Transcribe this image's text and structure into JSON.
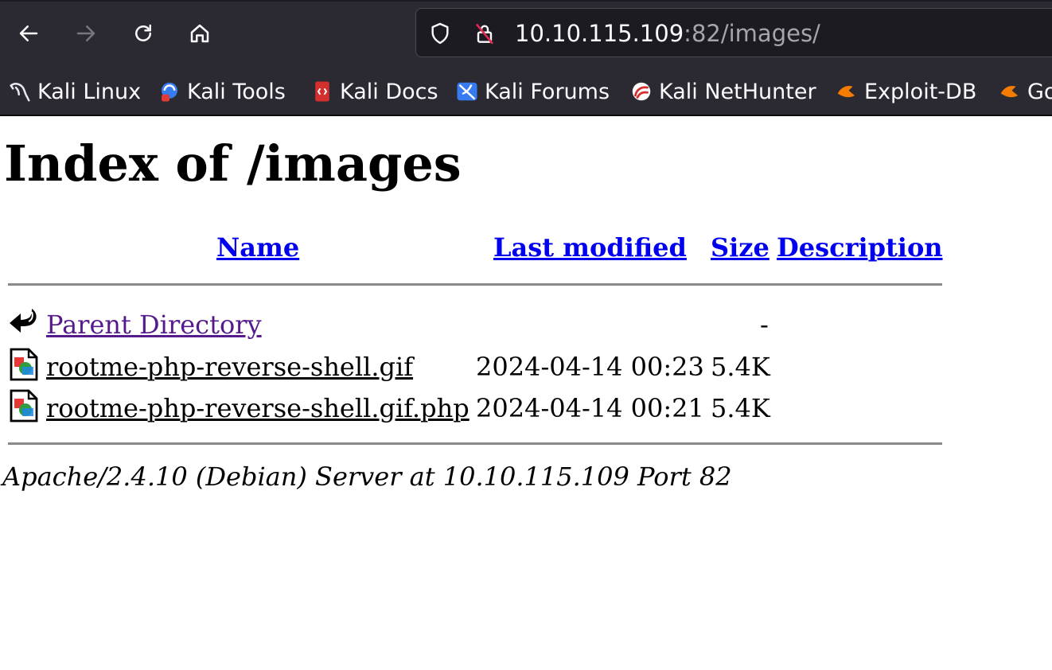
{
  "browser": {
    "address_host": "10.10.115.109",
    "address_rest": ":82/images/",
    "bookmarks": [
      {
        "label": "Kali Linux",
        "icon": "kali-dragon-icon"
      },
      {
        "label": "Kali Tools",
        "icon": "kali-tools-icon"
      },
      {
        "label": "Kali Docs",
        "icon": "kali-docs-icon"
      },
      {
        "label": "Kali Forums",
        "icon": "kali-forums-icon"
      },
      {
        "label": "Kali NetHunter",
        "icon": "kali-nethunter-icon"
      },
      {
        "label": "Exploit-DB",
        "icon": "exploit-db-icon"
      },
      {
        "label": "Go",
        "icon": "google-hacking-db-icon"
      }
    ]
  },
  "page": {
    "title": "Index of /images",
    "columns": {
      "name": "Name",
      "last_modified": "Last modified",
      "size": "Size",
      "description": "Description"
    },
    "rows": [
      {
        "name": "Parent Directory",
        "modified": "",
        "size": "-",
        "description": "",
        "icon": "back-arrow-icon"
      },
      {
        "name": "rootme-php-reverse-shell.gif",
        "modified": "2024-04-14 00:23",
        "size": "5.4K",
        "description": "",
        "icon": "image-file-icon"
      },
      {
        "name": "rootme-php-reverse-shell.gif.php",
        "modified": "2024-04-14 00:21",
        "size": "5.4K",
        "description": "",
        "icon": "image-file-icon"
      }
    ],
    "footer": "Apache/2.4.10 (Debian) Server at 10.10.115.109 Port 82"
  },
  "colors": {
    "chrome_bg": "#2b2a33",
    "urlbar_bg": "#1c1b22",
    "link": "#0000ee",
    "visited_link": "#551a8b"
  }
}
